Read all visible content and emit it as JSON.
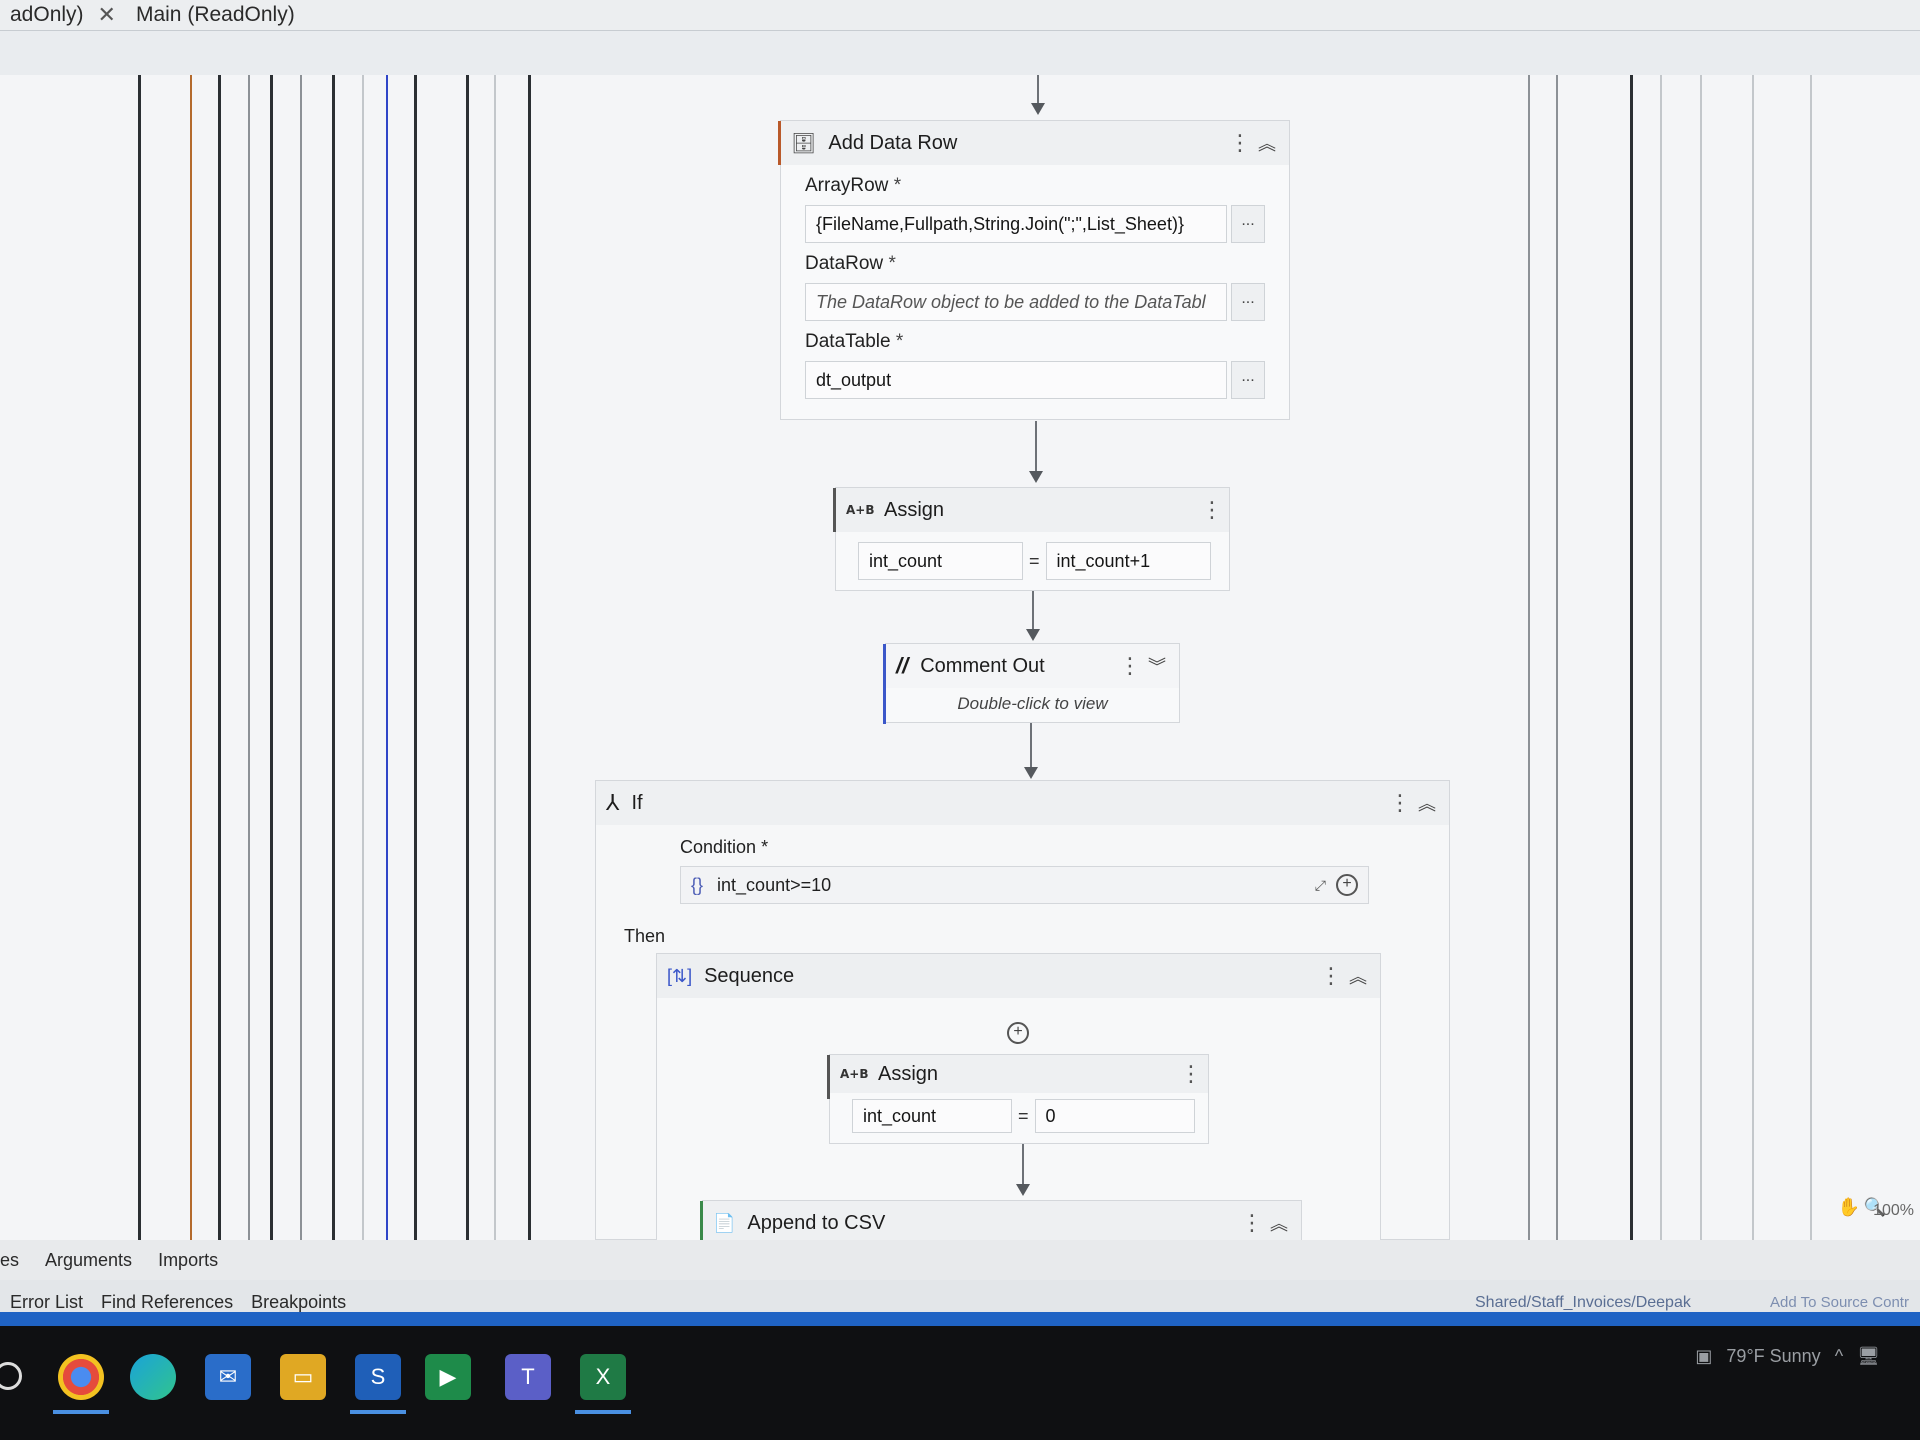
{
  "tabs": [
    {
      "label": "adOnly)"
    },
    {
      "label": "Main (ReadOnly)"
    }
  ],
  "add_data_row": {
    "title": "Add Data Row",
    "array_row_label": "ArrayRow",
    "array_row_value": "{FileName,Fullpath,String.Join(\";\",List_Sheet)}",
    "data_row_label": "DataRow",
    "data_row_placeholder": "The DataRow object to be added to the DataTabl",
    "data_table_label": "DataTable",
    "data_table_value": "dt_output",
    "required_mark": "*",
    "browse_label": "..."
  },
  "assign1": {
    "title": "Assign",
    "icon_text": "A+B",
    "to": "int_count",
    "value": "int_count+1",
    "equals": "="
  },
  "comment_out": {
    "title": "Comment Out",
    "hint": "Double-click to view"
  },
  "if_activity": {
    "title": "If",
    "condition_label": "Condition",
    "condition_value": "int_count>=10",
    "brace": "{}",
    "then_label": "Then"
  },
  "sequence": {
    "title": "Sequence"
  },
  "assign2": {
    "title": "Assign",
    "icon_text": "A+B",
    "to": "int_count",
    "value": "0",
    "equals": "="
  },
  "append_csv": {
    "title": "Append to CSV"
  },
  "panel_tabs_top": [
    "es",
    "Arguments",
    "Imports"
  ],
  "panel_tabs_bottom": [
    "Error List",
    "Find References",
    "Breakpoints"
  ],
  "status": {
    "path": "Shared/Staff_Invoices/Deepak",
    "source_control": "Add To Source Contr",
    "zoom": "100%"
  },
  "tray": {
    "weather": "79°F  Sunny"
  },
  "colors": {
    "accent_orange": "#b9592a",
    "accent_blue": "#3b57c9",
    "statusbar_blue": "#1f63c4"
  },
  "icons": [
    "database-icon",
    "assign-icon",
    "comment-out-icon",
    "if-icon",
    "sequence-icon",
    "append-csv-icon",
    "chrome-icon",
    "edge-icon",
    "outlook-icon",
    "explorer-icon",
    "uipath-studio-icon",
    "uipath-robot-icon",
    "teams-icon",
    "excel-icon"
  ]
}
